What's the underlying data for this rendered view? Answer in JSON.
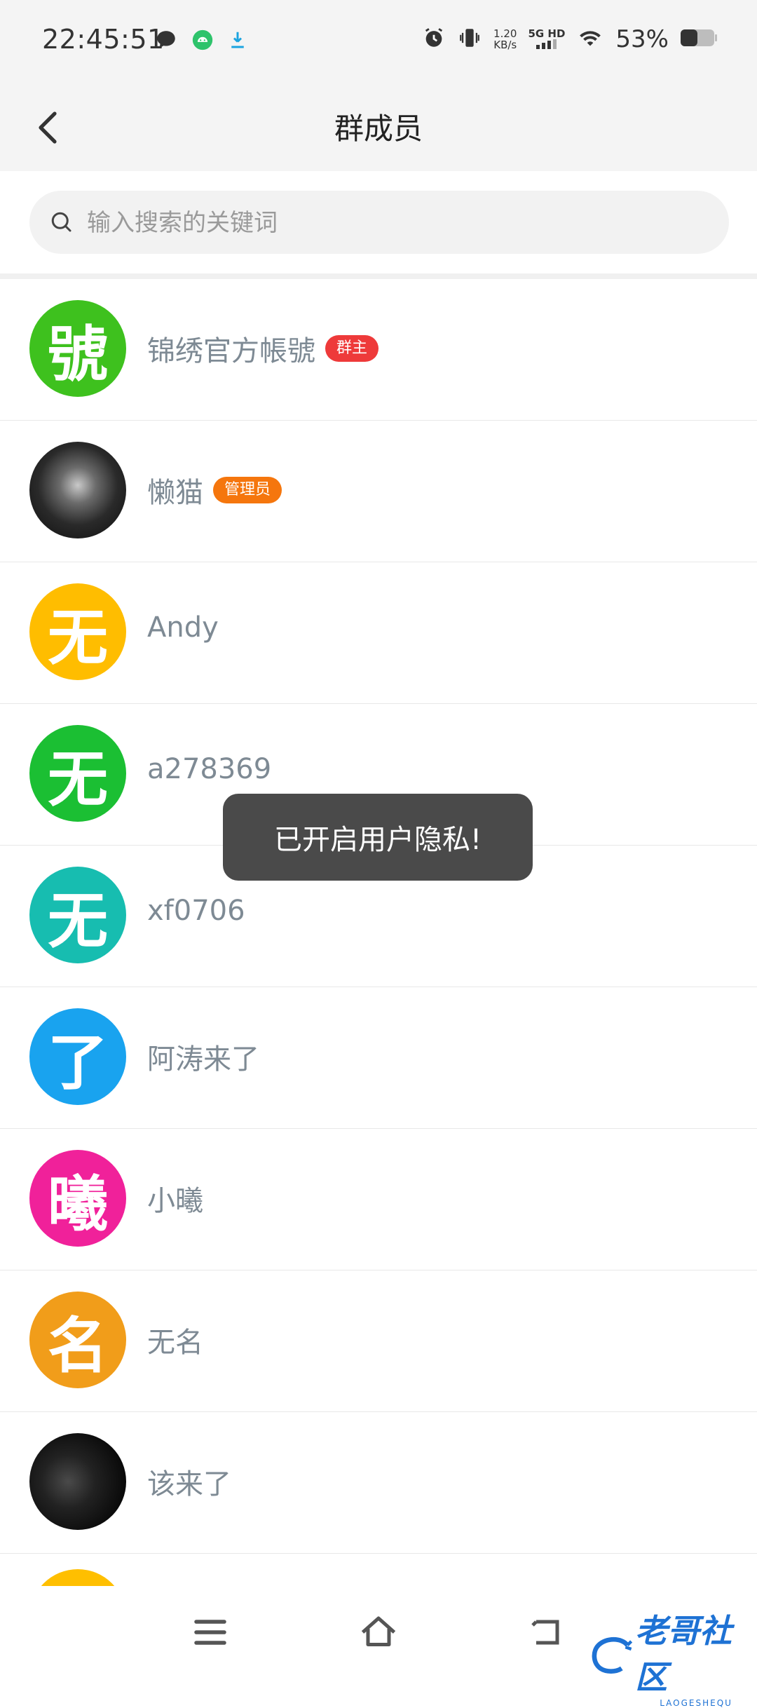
{
  "status_bar": {
    "time": "22:45:51",
    "speed": "1.20",
    "speed_unit": "KB/s",
    "network": "5G HD",
    "battery": "53%"
  },
  "header": {
    "title": "群成员",
    "back_icon": "chevron-left-icon"
  },
  "search": {
    "placeholder": "输入搜索的关键词",
    "value": ""
  },
  "members": [
    {
      "name": "锦绣官方帳號",
      "avatar_text": "號",
      "avatar_color": "#3ec11e",
      "badge": "群主",
      "badge_color": "#ee3a3a"
    },
    {
      "name": "懒猫",
      "avatar_text": "",
      "avatar_color": "#1b1b1b",
      "badge": "管理员",
      "badge_color": "#f5760d",
      "avatar_type": "photo-cat"
    },
    {
      "name": "Andy",
      "avatar_text": "无",
      "avatar_color": "#ffbd00",
      "badge": ""
    },
    {
      "name": "a278369",
      "avatar_text": "无",
      "avatar_color": "#1bbf33",
      "badge": ""
    },
    {
      "name": "xf0706",
      "avatar_text": "无",
      "avatar_color": "#17bdb0",
      "badge": ""
    },
    {
      "name": "阿涛来了",
      "avatar_text": "了",
      "avatar_color": "#19a3ef",
      "badge": ""
    },
    {
      "name": "小曦",
      "avatar_text": "曦",
      "avatar_color": "#f0219a",
      "badge": ""
    },
    {
      "name": "无名",
      "avatar_text": "名",
      "avatar_color": "#f19d1a",
      "badge": ""
    },
    {
      "name": "该来了",
      "avatar_text": "",
      "avatar_color": "#111111",
      "badge": "",
      "avatar_type": "photo-dark"
    }
  ],
  "toast": {
    "message": "已开启用户隐私!"
  },
  "watermark": {
    "text": "老哥社区",
    "subtext": "LAOGESHEQU"
  }
}
